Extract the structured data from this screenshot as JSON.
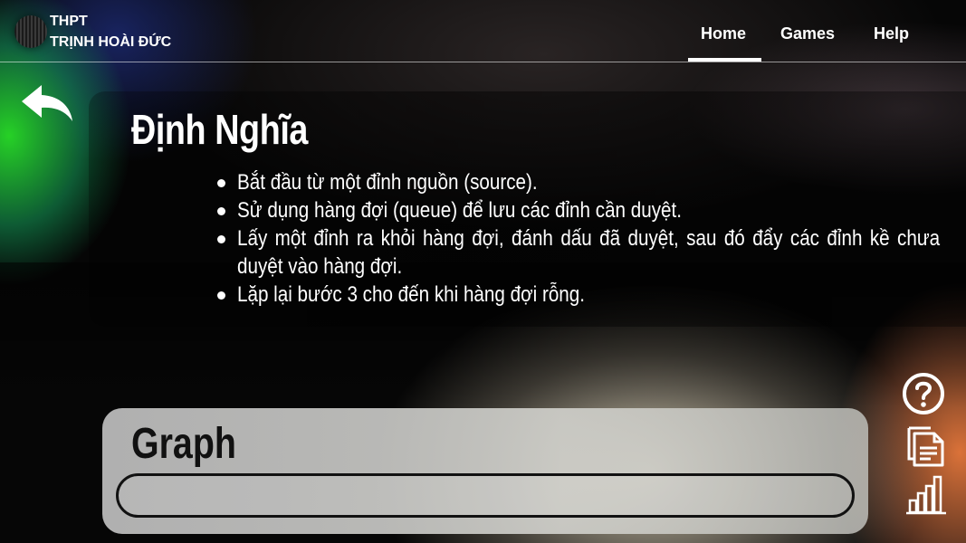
{
  "header": {
    "school_line1": "THPT",
    "school_line2": "TRỊNH HOÀI ĐỨC",
    "nav": [
      {
        "label": "Home",
        "active": true
      },
      {
        "label": "Games",
        "active": false
      },
      {
        "label": "Help",
        "active": false
      }
    ]
  },
  "main": {
    "title": "Định Nghĩa",
    "bullets": [
      "Bắt đầu từ một đỉnh nguồn (source).",
      "Sử dụng hàng đợi (queue) để lưu các đỉnh cần duyệt.",
      "Lấy một đỉnh ra khỏi hàng đợi, đánh dấu đã duyệt, sau đó đẩy các đỉnh kề chưa duyệt vào hàng đợi.",
      "Lặp lại bước 3 cho đến khi hàng đợi rỗng."
    ]
  },
  "graph_card": {
    "title": "Graph"
  },
  "icons": {
    "back": "back-arrow-icon",
    "help": "question-circle-icon",
    "docs": "documents-icon",
    "chart": "bar-chart-icon"
  },
  "colors": {
    "text": "#ffffff",
    "card_text": "#111111",
    "accent_green": "#28dc28",
    "accent_orange": "#e6783c"
  }
}
